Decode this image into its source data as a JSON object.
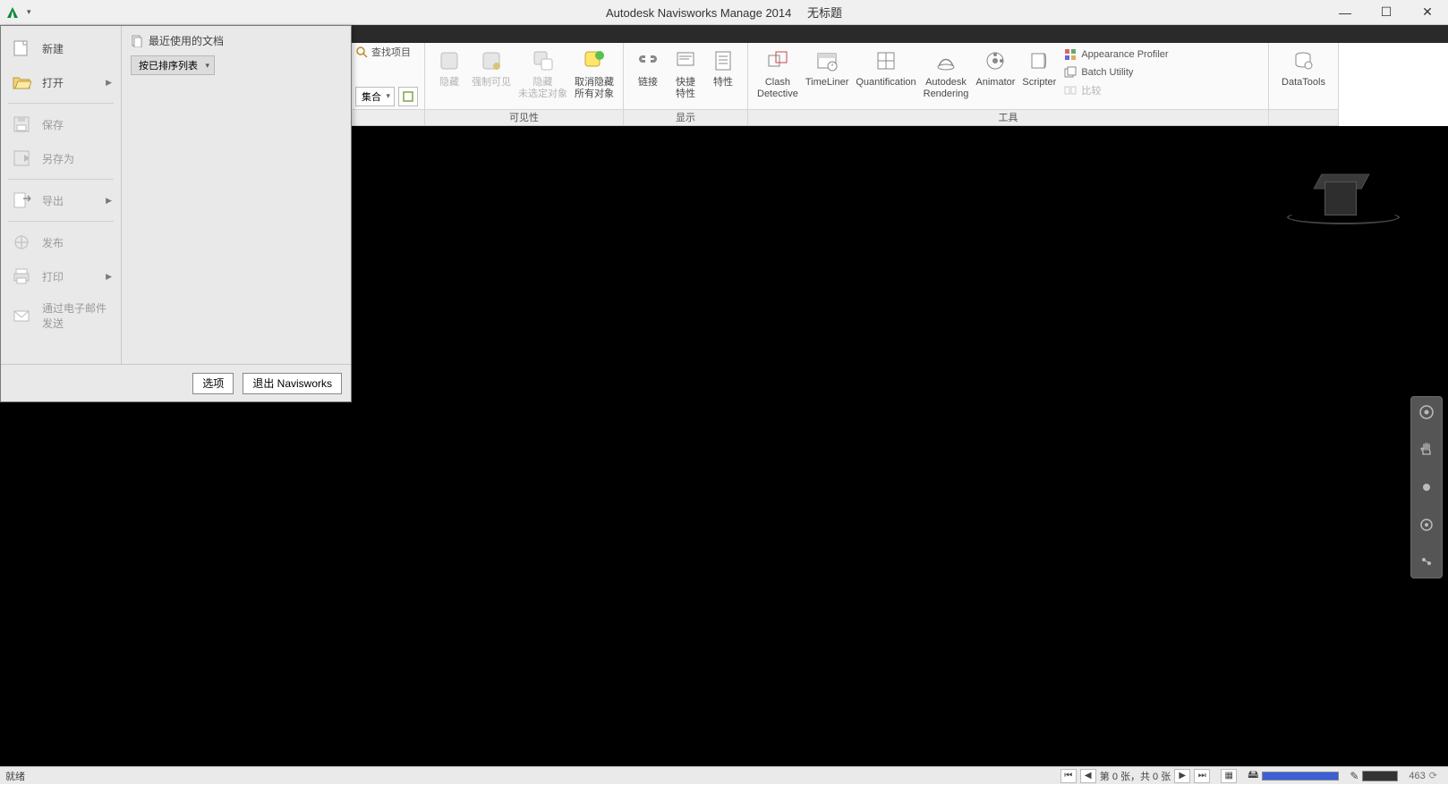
{
  "titlebar": {
    "app": "Autodesk Navisworks Manage 2014",
    "doc": "无标题"
  },
  "app_menu": {
    "items": {
      "new": "新建",
      "open": "打开",
      "save": "保存",
      "saveas": "另存为",
      "export": "导出",
      "publish": "发布",
      "print": "打印",
      "email": "通过电子邮件\n发送"
    },
    "recent_header": "最近使用的文档",
    "sort_button": "按已排序列表",
    "footer": {
      "options": "选项",
      "exit": "退出 Navisworks"
    }
  },
  "ribbon": {
    "peek": {
      "find": "查找项目",
      "set": "集合"
    },
    "visibility": {
      "group_label": "可见性",
      "hide": "隐藏",
      "require": "强制可见",
      "hide_unsel": "隐藏\n未选定对象",
      "unhide_all": "取消隐藏\n所有对象"
    },
    "display": {
      "group_label": "显示",
      "links": "链接",
      "quick_props": "快捷\n特性",
      "properties": "特性"
    },
    "tools": {
      "group_label": "工具",
      "clash": "Clash\nDetective",
      "timeliner": "TimeLiner",
      "quant": "Quantification",
      "render": "Autodesk\nRendering",
      "animator": "Animator",
      "scripter": "Scripter",
      "appearance": "Appearance Profiler",
      "batch": "Batch Utility",
      "compare": "比较"
    },
    "datatools": {
      "group_label": "",
      "label": "DataTools"
    }
  },
  "statusbar": {
    "ready": "就绪",
    "sheet": "第 0 张，共 0 张",
    "value": "463"
  }
}
